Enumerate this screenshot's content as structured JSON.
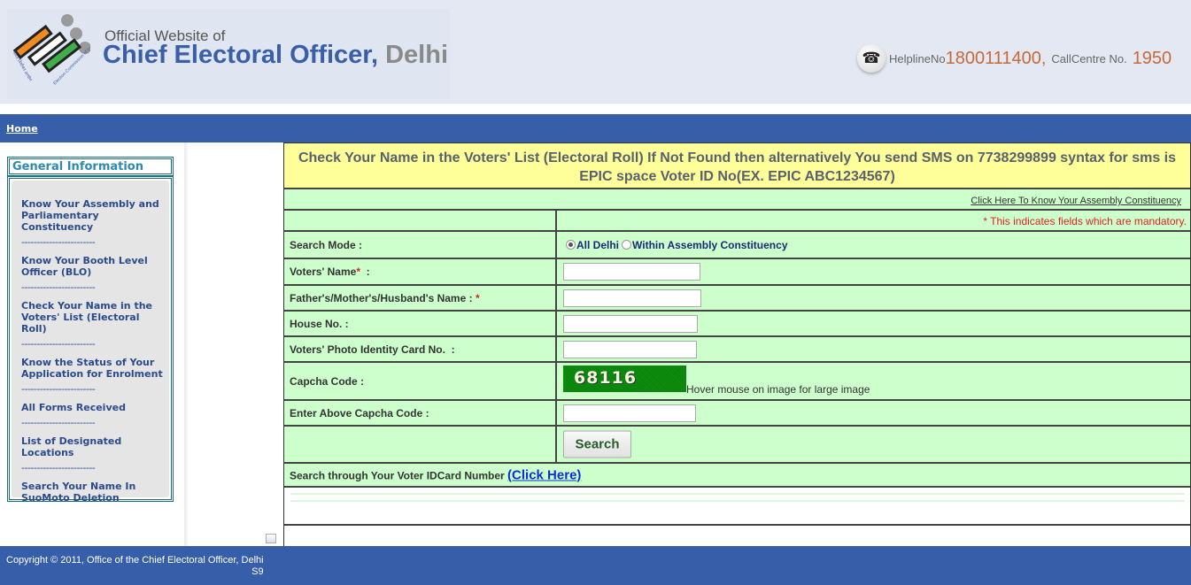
{
  "header": {
    "subtitle": "Official Website of",
    "title_main": "Chief Electoral Officer,",
    "title_city": "Delhi",
    "helpline_label": "HelplineNo",
    "helpline_number": "1800111400,",
    "callcentre_label": "CallCentre No.",
    "callcentre_number": "1950",
    "phone_icon": "telephone-icon"
  },
  "nav": {
    "home": "Home"
  },
  "sidebar": {
    "title": "General Information",
    "separator": "------------------------",
    "items": [
      {
        "label": "Know Your Assembly and Parliamentary Constituency"
      },
      {
        "label": "Know Your Booth Level Officer (BLO)"
      },
      {
        "label": "Check Your Name in the Voters' List (Electoral Roll)"
      },
      {
        "label": "Know the Status of Your Application for Enrolment"
      },
      {
        "label": "All Forms Received"
      },
      {
        "label": "List of Designated Locations"
      },
      {
        "label": "Search Your Name In SuoMoto Deletion"
      }
    ]
  },
  "main": {
    "banner": "Check Your Name in the Voters' List (Electoral Roll) If Not Found then alternatively You send SMS on 7738299899 syntax for sms is EPIC space Voter ID No(EX. EPIC ABC1234567)",
    "ac_link": "Click Here To Know Your Assembly Constituency",
    "mandatory_note": "* This indicates fields which are mandatory.",
    "search_mode": {
      "label": "Search Mode :",
      "options": [
        {
          "label": "All Delhi",
          "selected": true
        },
        {
          "label": "Within Assembly Constituency",
          "selected": false
        }
      ]
    },
    "fields": {
      "voter_name": {
        "label": "Voters' Name",
        "req": "*",
        "suffix": "  :",
        "value": ""
      },
      "relative_name": {
        "label": "Father's/Mother's/Husband's Name : ",
        "req": "*",
        "value": ""
      },
      "house_no": {
        "label": "House No. :",
        "value": ""
      },
      "epic_no": {
        "label": "Voters' Photo Identity Card No.  :",
        "value": ""
      },
      "captcha": {
        "label": "Capcha Code :",
        "code": "68116",
        "hint": "Hover mouse on image for large image"
      },
      "captcha_input": {
        "label": "Enter Above Capcha Code :",
        "value": ""
      }
    },
    "search_button": "Search",
    "voterid_text": "Search through Your Voter IDCard Number ",
    "voterid_link": "(Click Here)"
  },
  "footer": {
    "copyright": "Copyright © 2011, Office of the Chief Electoral Officer, Delhi",
    "code": "S9"
  },
  "colors": {
    "nav_blue": "#375ea9",
    "title_blue": "#3a5fa8",
    "helpline_orange": "#c8693a",
    "banner_yellow": "#ffff99",
    "form_green": "#ccffcc",
    "captcha_green": "#0c8c0c",
    "required_red": "#dd2222"
  }
}
